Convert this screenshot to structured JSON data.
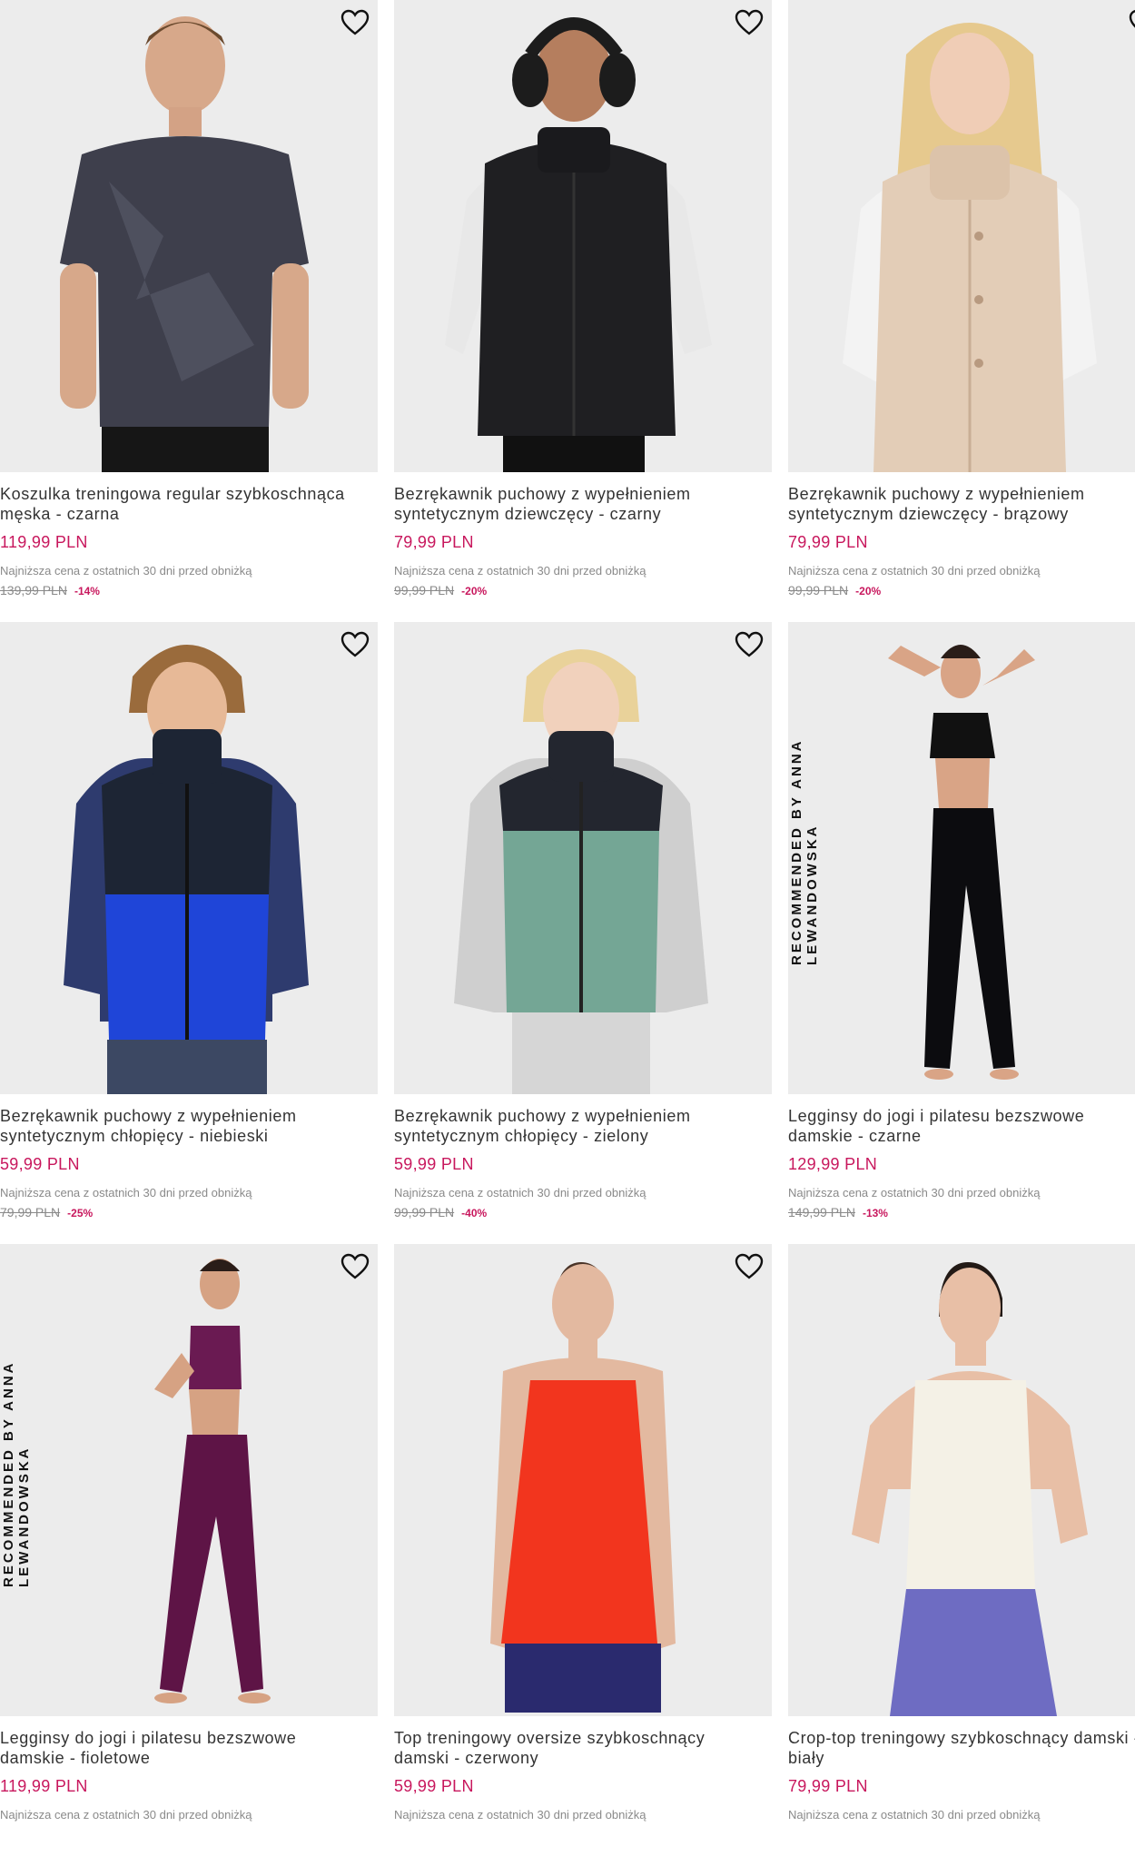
{
  "ui": {
    "badge_text": "RECOMMENDED BY ANNA LEWANDOWSKA",
    "lowest_price_note": "Najniższa cena z ostatnich 30 dni przed obniżką",
    "accent_color": "#c8175d"
  },
  "products": [
    {
      "name": "Koszulka treningowa regular szybkoschnąca\nmęska - czarna",
      "price": "119,99 PLN",
      "old_price": "139,99 PLN",
      "discount": "-14%"
    },
    {
      "name": "Bezrękawnik puchowy z wypełnieniem\nsyntetycznym dziewczęcy - czarny",
      "price": "79,99 PLN",
      "old_price": "99,99 PLN",
      "discount": "-20%"
    },
    {
      "name": "Bezrękawnik puchowy z wypełnieniem\nsyntetycznym dziewczęcy - brązowy",
      "price": "79,99 PLN",
      "old_price": "99,99 PLN",
      "discount": "-20%"
    },
    {
      "name": "Bezrękawnik puchowy z wypełnieniem\nsyntetycznym chłopięcy - niebieski",
      "price": "59,99 PLN",
      "old_price": "79,99 PLN",
      "discount": "-25%"
    },
    {
      "name": "Bezrękawnik puchowy z wypełnieniem\nsyntetycznym chłopięcy - zielony",
      "price": "59,99 PLN",
      "old_price": "99,99 PLN",
      "discount": "-40%"
    },
    {
      "name": "Legginsy do jogi i pilatesu bezszwowe\ndamskie - czarne",
      "price": "129,99 PLN",
      "old_price": "149,99 PLN",
      "discount": "-13%"
    },
    {
      "name": "Legginsy do jogi i pilatesu bezszwowe\ndamskie - fioletowe",
      "price": "119,99 PLN"
    },
    {
      "name": "Top treningowy oversize szybkoschnący\ndamski - czerwony",
      "price": "59,99 PLN"
    },
    {
      "name": "Crop-top treningowy szybkoschnący damski -\nbiały",
      "price": "79,99 PLN"
    }
  ]
}
